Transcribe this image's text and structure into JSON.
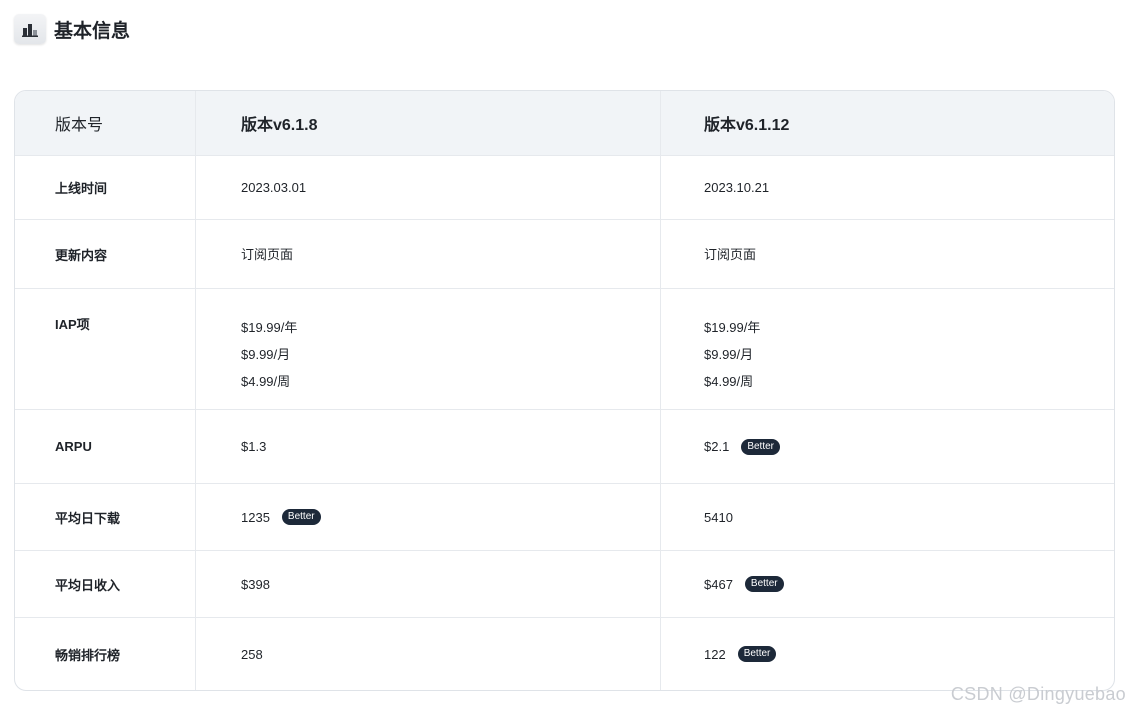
{
  "header": {
    "title": "基本信息",
    "icon": "bar-chart-icon"
  },
  "table": {
    "columns": [
      "版本号",
      "版本v6.1.8",
      "版本v6.1.12"
    ],
    "rows": [
      {
        "label": "上线时间",
        "v1": [
          "2023.03.01"
        ],
        "v1_badge": "",
        "v2": [
          "2023.10.21"
        ],
        "v2_badge": ""
      },
      {
        "label": "更新内容",
        "v1": [
          "订阅页面"
        ],
        "v1_badge": "",
        "v2": [
          "订阅页面"
        ],
        "v2_badge": ""
      },
      {
        "label": "IAP项",
        "v1": [
          "$19.99/年",
          "$9.99/月",
          "$4.99/周"
        ],
        "v1_badge": "",
        "v2": [
          "$19.99/年",
          "$9.99/月",
          "$4.99/周"
        ],
        "v2_badge": ""
      },
      {
        "label": "ARPU",
        "v1": [
          "$1.3"
        ],
        "v1_badge": "",
        "v2": [
          "$2.1"
        ],
        "v2_badge": "Better"
      },
      {
        "label": "平均日下载",
        "v1": [
          "1235"
        ],
        "v1_badge": "Better",
        "v2": [
          "5410"
        ],
        "v2_badge": ""
      },
      {
        "label": "平均日收入",
        "v1": [
          "$398"
        ],
        "v1_badge": "",
        "v2": [
          "$467"
        ],
        "v2_badge": "Better"
      },
      {
        "label": "畅销排行榜",
        "v1": [
          "258"
        ],
        "v1_badge": "",
        "v2": [
          "122"
        ],
        "v2_badge": "Better"
      }
    ]
  },
  "watermark": "CSDN @Dingyuebao",
  "colors": {
    "header_bg": "#f1f4f7",
    "badge_bg": "#1d2939",
    "border": "#dfe3e8"
  }
}
